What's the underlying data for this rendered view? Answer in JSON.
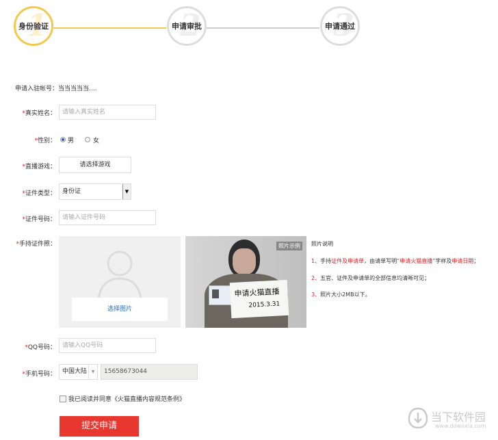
{
  "steps": [
    {
      "number": "1",
      "label": "身份验证",
      "active": true
    },
    {
      "number": "2",
      "label": "申请审批",
      "active": false
    },
    {
      "number": "3",
      "label": "申请通过",
      "active": false
    }
  ],
  "form": {
    "account_label": "申请入驻帐号：",
    "account_value": "当当当当当....",
    "required_mark": "*",
    "realname_label": "真实姓名：",
    "realname_placeholder": "请输入真实姓名",
    "gender_label": "性别：",
    "gender_male": "男",
    "gender_female": "女",
    "game_label": "直播游戏：",
    "game_button": "请选择游戏",
    "idtype_label": "证件类型：",
    "idtype_value": "身份证",
    "idnum_label": "证件号码：",
    "idnum_placeholder": "请输入证件号码",
    "photo_label": "手持证件照：",
    "photo_upload": "选择图片",
    "photo_example_tag": "照片示例",
    "qq_label": "QQ号码：",
    "qq_placeholder": "请输入QQ号码",
    "phone_label": "手机号码：",
    "phone_region": "中国大陆",
    "phone_value": "15658673044",
    "agree_prefix": "我已阅读并同意",
    "agree_link": "《火猫直播内容规范条例》",
    "submit": "提交申请"
  },
  "photo_notes": {
    "title": "照片说明",
    "n1_idx": "1、",
    "n1_a": "手持",
    "n1_b": "证件及申请单",
    "n1_c": "，由请单写明",
    "n1_d": "“申请火猫直播”",
    "n1_e": "字样及",
    "n1_f": "申请日期",
    "n1_g": "；",
    "n2_idx": "2、",
    "n2_text": "五官、证件及申请单的全部信息均清晰可见；",
    "n3_idx": "3、",
    "n3_text": "照片大小2MB以下。"
  },
  "sample_sign": {
    "line1": "申请火猫直播",
    "line2": "2015.3.31"
  },
  "watermark": {
    "text": "当下软件园",
    "url": "www.downxia.com"
  },
  "colors": {
    "accent_yellow": "#f2c94c",
    "submit_red": "#e8372e",
    "required_red": "#e02020",
    "link_blue": "#2a6db5"
  }
}
